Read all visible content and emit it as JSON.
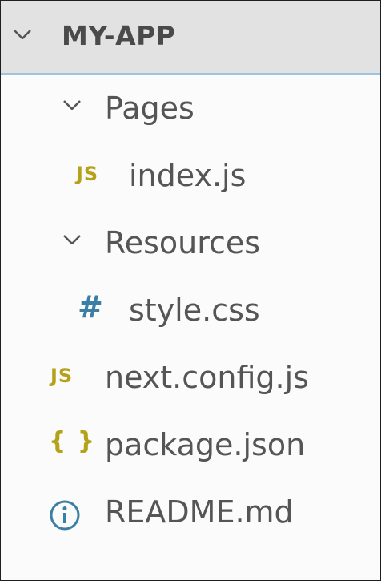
{
  "explorer": {
    "folder_name": "MY-APP",
    "items": [
      {
        "label": "Pages",
        "type": "folder",
        "icon": "chevron-down-icon"
      },
      {
        "label": "index.js",
        "type": "file",
        "icon": "js-file-icon",
        "icon_text": "JS"
      },
      {
        "label": "Resources",
        "type": "folder",
        "icon": "chevron-down-icon"
      },
      {
        "label": "style.css",
        "type": "file",
        "icon": "css-file-icon",
        "icon_text": "#"
      },
      {
        "label": "next.config.js",
        "type": "file",
        "icon": "js-file-icon",
        "icon_text": "JS"
      },
      {
        "label": "package.json",
        "type": "file",
        "icon": "json-file-icon",
        "icon_text": "{ }"
      },
      {
        "label": "README.md",
        "type": "file",
        "icon": "info-icon"
      }
    ]
  },
  "colors": {
    "js_icon": "#b5a21a",
    "css_icon": "#3c7fa4",
    "json_icon": "#b5a21a",
    "info_icon": "#3c7fa4",
    "header_bg": "#e2e2e2",
    "header_border": "#9cc4e0"
  }
}
